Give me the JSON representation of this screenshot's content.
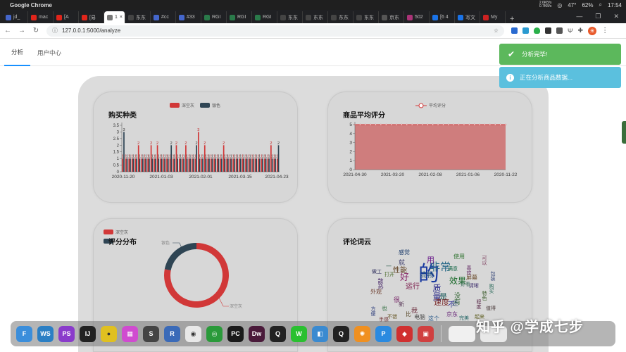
{
  "macbar": {
    "app_name": "Google Chrome",
    "net_up": "2.6KB/s",
    "net_down": "0.7KB/s",
    "temp": "47°",
    "battery": "62%",
    "time": "17:54"
  },
  "tabs": [
    {
      "label": "jd_",
      "fav": "#4466cc"
    },
    {
      "label": "mac",
      "fav": "#e1251b"
    },
    {
      "label": "[A",
      "fav": "#e1251b"
    },
    {
      "label": "[易",
      "fav": "#e1251b"
    },
    {
      "label": "1",
      "fav": "#777777",
      "active": true
    },
    {
      "label": "东东",
      "fav": "#444444"
    },
    {
      "label": "#cc",
      "fav": "#4466cc"
    },
    {
      "label": "#33",
      "fav": "#4466cc"
    },
    {
      "label": "RGI",
      "fav": "#2a7a4a"
    },
    {
      "label": "RGI",
      "fav": "#2a7a4a"
    },
    {
      "label": "RGI",
      "fav": "#2a7a4a"
    },
    {
      "label": "东东",
      "fav": "#444444"
    },
    {
      "label": "东东",
      "fav": "#444444"
    },
    {
      "label": "东东",
      "fav": "#444444"
    },
    {
      "label": "东东",
      "fav": "#444444"
    },
    {
      "label": "京东",
      "fav": "#555555"
    },
    {
      "label": "502",
      "fav": "#aa3377"
    },
    {
      "label": "[6 4",
      "fav": "#1a73e8"
    },
    {
      "label": "写文",
      "fav": "#1a73e8"
    },
    {
      "label": "My",
      "fav": "#cc2222"
    }
  ],
  "address": {
    "url": "127.0.0.1:5000/analyze"
  },
  "nav": {
    "analyze": "分析",
    "user_center": "用户中心"
  },
  "toasts": {
    "success": "分析完毕!",
    "info": "正在分析商品数据..."
  },
  "colors": {
    "red": "#d13838",
    "dark": "#2f4554",
    "area": "#cf7878"
  },
  "chart_data": [
    {
      "id": "purchase-types",
      "type": "bar",
      "title": "购买种类",
      "legend": [
        "深空灰",
        "银色"
      ],
      "ylim": [
        0,
        3.5
      ],
      "yticks": [
        "0",
        "0.5",
        "1",
        "1.5",
        "2",
        "2.5",
        "3",
        "3.5"
      ],
      "xticks": [
        "2020-11-20",
        "2021-01-03",
        "2021-02-01",
        "2021-03-15",
        "2021-04-23"
      ],
      "series": [
        {
          "name": "深空灰",
          "values": [
            1,
            1,
            1,
            1,
            1,
            2,
            1,
            1,
            1,
            2,
            1,
            2,
            1,
            1,
            1,
            1,
            1,
            2,
            1,
            1,
            2,
            1,
            1,
            1,
            3,
            1,
            2,
            1,
            1,
            1,
            1,
            1,
            2,
            1,
            1,
            1,
            1,
            1,
            1,
            1,
            1,
            1,
            1,
            1,
            1,
            1,
            1,
            2,
            1,
            1
          ]
        },
        {
          "name": "银色",
          "values": [
            3,
            1,
            1,
            1,
            1,
            1,
            1,
            1,
            1,
            1,
            1,
            1,
            1,
            1,
            1,
            2,
            1,
            1,
            1,
            1,
            1,
            1,
            1,
            2,
            1,
            1,
            1,
            1,
            1,
            1,
            1,
            1,
            1,
            1,
            1,
            1,
            1,
            1,
            1,
            1,
            1,
            1,
            1,
            1,
            1,
            1,
            1,
            1,
            1,
            2
          ]
        }
      ]
    },
    {
      "id": "avg-rating",
      "type": "area",
      "title": "商品平均评分",
      "legend": [
        "平均评分"
      ],
      "ylim": [
        0,
        5
      ],
      "yticks": [
        "0",
        "1",
        "2",
        "3",
        "4",
        "5"
      ],
      "xticks": [
        "2021-04-30",
        "2021-03-20",
        "2021-02-08",
        "2021-01-06",
        "2020-11-22"
      ],
      "values": [
        5,
        5,
        5,
        5,
        5,
        5,
        5,
        5,
        5,
        5,
        5,
        5,
        5,
        5,
        5,
        5,
        5,
        5,
        5,
        5,
        5,
        5,
        5,
        5,
        5,
        5,
        5,
        5,
        5,
        5
      ]
    },
    {
      "id": "rating-distribution",
      "type": "pie",
      "title": "评分分布",
      "legend": [
        "深空灰",
        "银色"
      ],
      "slices": [
        {
          "name": "深空灰",
          "value": 78
        },
        {
          "name": "银色",
          "value": 22
        }
      ],
      "outer_labels": [
        "银色",
        "深空灰"
      ]
    }
  ],
  "wordcloud": {
    "title": "评论词云",
    "words": [
      {
        "t": "的",
        "s": 30,
        "c": "#1a3aa0"
      },
      {
        "t": "非常",
        "s": 15,
        "c": "#2a6a8a"
      },
      {
        "t": "好",
        "s": 13,
        "c": "#8a2a6a"
      },
      {
        "t": "质量",
        "s": 12,
        "c": "#2a2a8a"
      },
      {
        "t": "效果",
        "s": 12,
        "c": "#1a6a2a"
      },
      {
        "t": "用",
        "s": 11,
        "c": "#6a1a8a"
      },
      {
        "t": "是",
        "s": 11,
        "c": "#1a5a5a"
      },
      {
        "t": "速度",
        "s": 11,
        "c": "#7a2a2a"
      },
      {
        "t": "不",
        "s": 10,
        "c": "#3a3a9a"
      },
      {
        "t": "性能",
        "s": 10,
        "c": "#5a3a1a"
      },
      {
        "t": "运行",
        "s": 10,
        "c": "#7a1a4a"
      },
      {
        "t": "流畅",
        "s": 10,
        "c": "#1a4a7a"
      },
      {
        "t": "没有",
        "s": 9,
        "c": "#3a6a3a"
      },
      {
        "t": "京东",
        "s": 8,
        "c": "#6a2a7a"
      },
      {
        "t": "电脑",
        "s": 8,
        "c": "#4a4a4a"
      },
      {
        "t": "这个",
        "s": 8,
        "c": "#2a5a8a"
      },
      {
        "t": "使用",
        "s": 8,
        "c": "#3a7a3a"
      },
      {
        "t": "感觉",
        "s": 8,
        "c": "#1a3a6a"
      },
      {
        "t": "外观",
        "s": 8,
        "c": "#6a3a2a"
      },
      {
        "t": "散热",
        "s": 8,
        "c": "#4a2a6a"
      },
      {
        "t": "完美",
        "s": 7,
        "c": "#2a6a6a"
      },
      {
        "t": "起来",
        "s": 7,
        "c": "#5a5a1a"
      },
      {
        "t": "可以",
        "s": 7,
        "c": "#7a3a5a"
      },
      {
        "t": "特色",
        "s": 7,
        "c": "#3a5a2a"
      },
      {
        "t": "喜欢",
        "s": 7,
        "c": "#5a1a5a"
      },
      {
        "t": "满意",
        "s": 7,
        "c": "#1a6a4a"
      },
      {
        "t": "就",
        "s": 9,
        "c": "#3a3a6a"
      },
      {
        "t": "我",
        "s": 9,
        "c": "#6a2a3a"
      },
      {
        "t": "还",
        "s": 9,
        "c": "#2a4a6a"
      },
      {
        "t": "比",
        "s": 8,
        "c": "#5a4a2a"
      },
      {
        "t": "也",
        "s": 8,
        "c": "#2a6a3a"
      },
      {
        "t": "很",
        "s": 9,
        "c": "#7a2a6a"
      },
      {
        "t": "打开",
        "s": 7,
        "c": "#4a6a2a"
      },
      {
        "t": "方便",
        "s": 7,
        "c": "#2a3a7a"
      },
      {
        "t": "屏幕",
        "s": 8,
        "c": "#6a4a2a"
      },
      {
        "t": "清晰",
        "s": 7,
        "c": "#3a2a6a"
      },
      {
        "t": "程度",
        "s": 7,
        "c": "#5a2a4a"
      },
      {
        "t": "一",
        "s": 8,
        "c": "#2a5a4a"
      },
      {
        "t": "新",
        "s": 8,
        "c": "#5a3a5a"
      },
      {
        "t": "好看",
        "s": 7,
        "c": "#3a6a5a"
      },
      {
        "t": "不错",
        "s": 7,
        "c": "#6a5a2a"
      },
      {
        "t": "做工",
        "s": 7,
        "c": "#2a2a5a"
      },
      {
        "t": "手感",
        "s": 7,
        "c": "#6a2a2a"
      },
      {
        "t": "包装",
        "s": 7,
        "c": "#3a4a7a"
      },
      {
        "t": "值得",
        "s": 7,
        "c": "#4a3a3a"
      },
      {
        "t": "购买",
        "s": 7,
        "c": "#2a6a5a"
      }
    ]
  },
  "dock": [
    {
      "label": "F",
      "bg": "#3b8edb"
    },
    {
      "label": "WS",
      "bg": "#2b7fc4"
    },
    {
      "label": "PS",
      "bg": "#8a3bcb"
    },
    {
      "label": "IJ",
      "bg": "#222222"
    },
    {
      "label": "●",
      "bg": "#e0c020"
    },
    {
      "label": "▦",
      "bg": "#d04bd0"
    },
    {
      "label": "S",
      "bg": "#444444"
    },
    {
      "label": "R",
      "bg": "#3a6ab8"
    },
    {
      "label": "◉",
      "bg": "#e8e8e8"
    },
    {
      "label": "◎",
      "bg": "#2a9a3a"
    },
    {
      "label": "PC",
      "bg": "#1a1a1a"
    },
    {
      "label": "Dw",
      "bg": "#4a1a3a"
    },
    {
      "label": "Q",
      "bg": "#222222"
    },
    {
      "label": "W",
      "bg": "#2ac030"
    },
    {
      "label": "◧",
      "bg": "#3a8ad0"
    },
    {
      "label": "Q",
      "bg": "#222222"
    },
    {
      "label": "✺",
      "bg": "#f09020"
    },
    {
      "label": "P",
      "bg": "#2a8ae0"
    },
    {
      "label": "◆",
      "bg": "#d03030"
    },
    {
      "label": "▣",
      "bg": "#d04040"
    }
  ],
  "watermark": "知乎 @学成七步"
}
